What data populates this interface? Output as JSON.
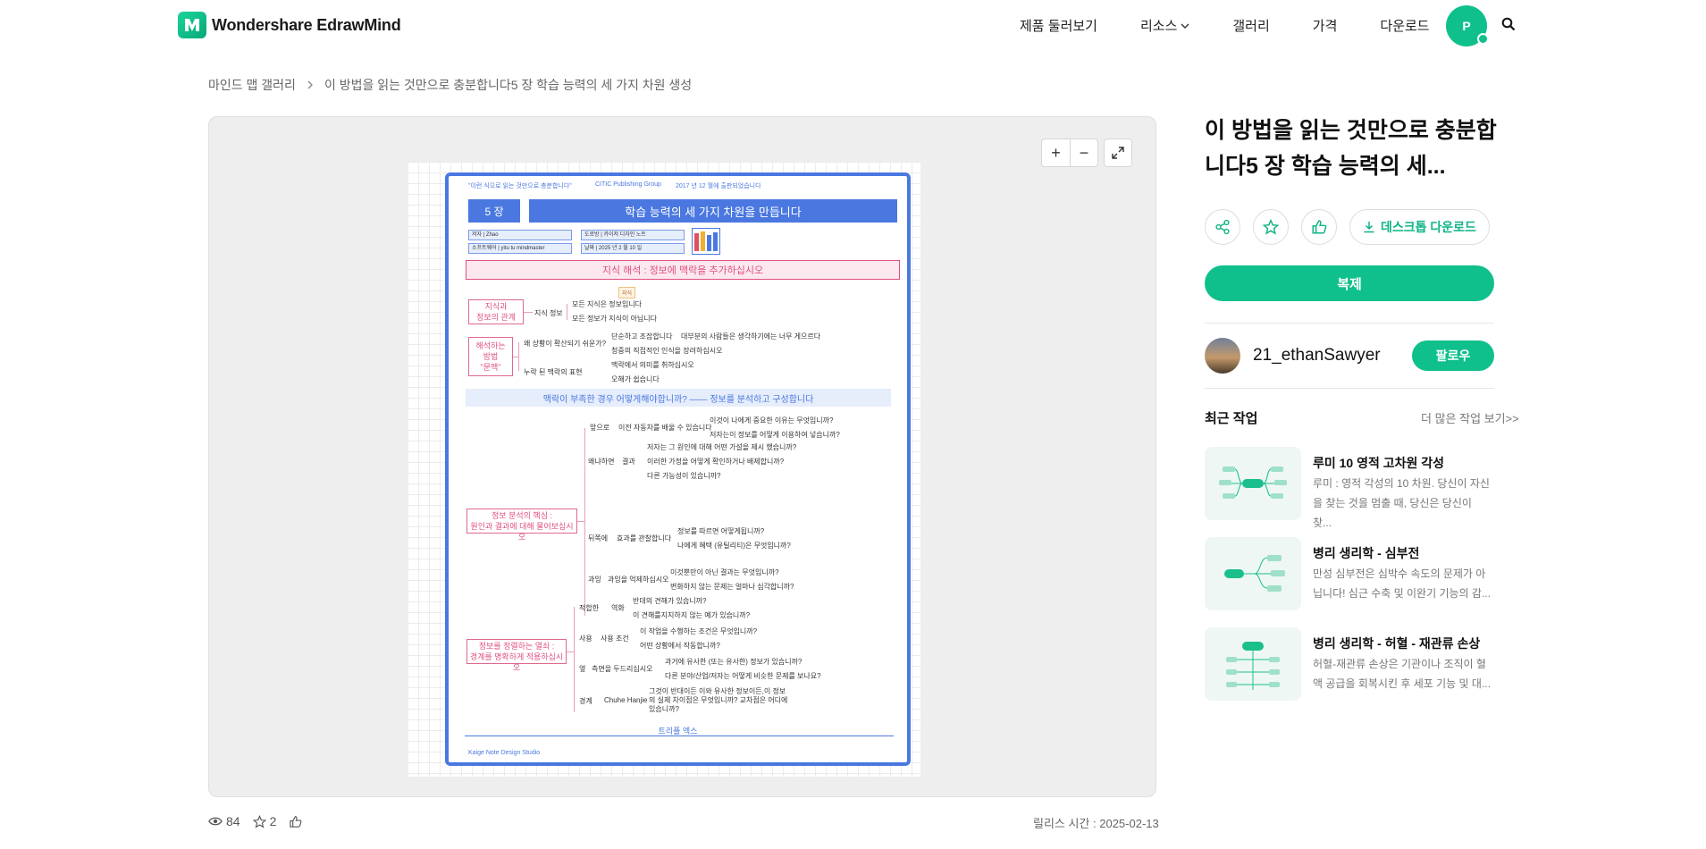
{
  "header": {
    "brand": "Wondershare EdrawMind",
    "nav": [
      "제품 둘러보기",
      "리소스",
      "갤러리",
      "가격",
      "다운로드"
    ],
    "avatar_letter": "P"
  },
  "breadcrumb": {
    "root": "마인드 맵 갤러리",
    "current": "이 방법을 읽는 것만으로 충분합니다5 장 학습 능력의 세 가지 차원 생성"
  },
  "preview": {
    "zoom_in": "+",
    "zoom_out": "−",
    "map": {
      "topline": [
        "\"이런 식으로 읽는 것만으로 충분합니다\"",
        "CITIC Publishing Group",
        "2017 년 12 월에 출판되었습니다"
      ],
      "chapter": "5 장",
      "heading": "학습 능력의 세 가지 차원을 만듭니다",
      "meta": [
        "저자 | Zhao",
        "도로방 | 카이저 디자인 노트",
        "소프트웨어 | yitu tu mindmaster",
        "날짜 | 2025 년 2 월 10 일"
      ],
      "section1": "지식 해석 : 정보에 맥락을 추가하십시오",
      "callout": "지식",
      "node1": "지식과\n정보의 관계",
      "node1_branch": "지식 정보",
      "node1_leaves": [
        "모든 지식은 정보입니다",
        "모든 정보가 지식이 아닙니다"
      ],
      "node2": "해석하는\n방법\n\"문맥\"",
      "node2_branches": [
        "왜 상황이 확산되기 쉬운가?",
        "누락 된 맥락의 표현"
      ],
      "node2_leaves": [
        "단순하고 조잡합니다",
        "대부분의 사람들은 생각하기에는 너무 게으르다",
        "청중의 직접적인 인식을 장려하십시오",
        "맥락에서 의미를 취하십시오",
        "오해가 쉽습니다"
      ],
      "section2": "맥락이 부족한 경우 어떻게해야합니까? —— 정보를 분석하고 구성합니다",
      "node3": "정보 분석의 핵심 :\n원인과 결과에 대해 물어보십시오",
      "node3_branches": [
        "앞으로",
        "왜냐하면",
        "결과",
        "뒤쪽에",
        "효과를 관찰합니다",
        "과잉",
        "과잉을 억제하십시오"
      ],
      "node3_leaves": [
        "이전 자동차를 배울 수 있습니다",
        "이것이 나에게 중요한 이유는 무엇입니까?",
        "저자는이 정보를 어떻게 이용하여 넣습니까?",
        "저자는 그 원인에 대해 어떤 가설을 제시 했습니까?",
        "이러한 가정을 어떻게 확인하거나 배제합니까?",
        "다른 가능성이 있습니까?",
        "정보를 따르면 어떻게됩니까?",
        "나에게 혜택 (유틸리티)은 무엇입니까?",
        "이것뿐만이 아닌 결과는 무엇입니까?",
        "변화하지 않는 문제는 얼마나 심각합니까?"
      ],
      "node4": "정보를 정렬하는 열쇠 :\n경계를 명확하게 적용하십시오",
      "node4_branches": [
        "적합한",
        "역화",
        "사용",
        "사용 조건",
        "옆",
        "측면을 두드리십시오",
        "경계",
        "Chuhe Hanjie"
      ],
      "node4_leaves": [
        "반대의 견해가 있습니까?",
        "이 견해를지지하지 않는 예가 있습니까?",
        "이 작업을 수행하는 조건은 무엇입니까?",
        "어떤 상황에서 작동합니까?",
        "과거에 유사한 (또는 유사한) 정보가 있습니까?",
        "다른 분야/산업/저자는 어떻게 비슷한 문제를 보나요?",
        "그것이 반대이든 이와 유사한 정보이든,이 정보의 실제 차이점은 무엇입니까? 교차점은 어디에 있습니까?"
      ],
      "footer_center": "트리플 엑스",
      "footer_studio": "Kaige Note Design Studio"
    }
  },
  "stats": {
    "views": "84",
    "stars": "2",
    "release_label": "릴리스 시간 : 2025-02-13"
  },
  "sidebar": {
    "title": "이 방법을 읽는 것만으로 충분합니다5 장 학습 능력의 세...",
    "download_label": "데스크톱 다운로드",
    "copy_label": "복제",
    "author_name": "21_ethanSawyer",
    "follow_label": "팔로우",
    "recent_title": "최근 작업",
    "more_label": "더 많은 작업 보기>>",
    "works": [
      {
        "title": "루미 10 영적 고차원 각성",
        "desc": "루미 : 영적 각성의 10 차원. 당신이 자신을 찾는 것을 멈출 때, 당신은 당신이 찾..."
      },
      {
        "title": "병리 생리학 - 심부전",
        "desc": "만성 심부전은 심박수 속도의 문제가 아닙니다! 심근 수축 및 이완기 기능의 감..."
      },
      {
        "title": "병리 생리학 - 허혈 - 재관류 손상",
        "desc": "허혈-재관류 손상은 기관이나 조직이 혈액 공급을 회복시킨 후 세포 기능 및 대..."
      }
    ]
  },
  "colors": {
    "accent": "#0fc08c",
    "map_blue": "#4a78e0",
    "map_pink": "#e05080"
  }
}
